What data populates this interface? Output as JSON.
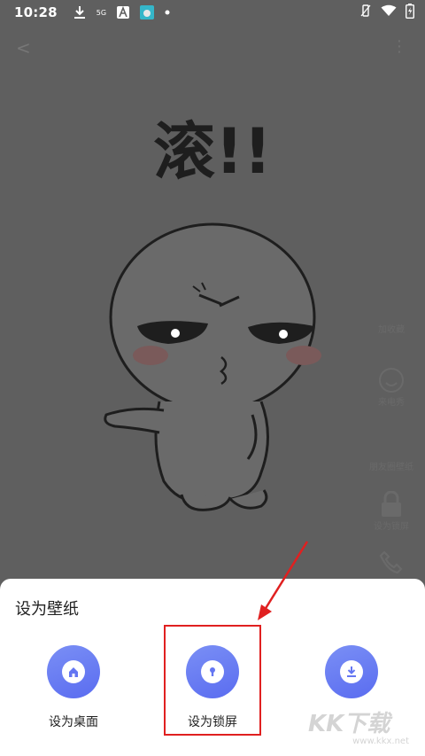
{
  "status_bar": {
    "time": "10:28",
    "network_label": "5G",
    "icons": [
      "download-icon",
      "signal-5g-icon",
      "app-a-icon",
      "app-cat-icon",
      "dot-icon",
      "vibrate-icon",
      "wifi-icon",
      "battery-charging-icon"
    ]
  },
  "preview": {
    "meme_text": "滚!!",
    "side_actions": [
      {
        "label": "加收藏",
        "icon": "star-icon"
      },
      {
        "label": "来电秀",
        "icon": "smiley-icon"
      },
      {
        "label": "朋友圈壁纸",
        "icon": "none"
      },
      {
        "label": "设为锁屏",
        "icon": "lock-icon"
      },
      {
        "label": "来电",
        "icon": "phone-icon"
      }
    ]
  },
  "sheet": {
    "title": "设为壁纸",
    "options": [
      {
        "label": "设为桌面",
        "icon": "home-icon"
      },
      {
        "label": "设为锁屏",
        "icon": "keyhole-icon"
      },
      {
        "label": "",
        "icon": "download-icon"
      }
    ],
    "accent_color": "#6476f2",
    "highlight_color": "#e02020"
  },
  "watermark": {
    "brand": "KK下载",
    "url": "www.kkx.net"
  }
}
